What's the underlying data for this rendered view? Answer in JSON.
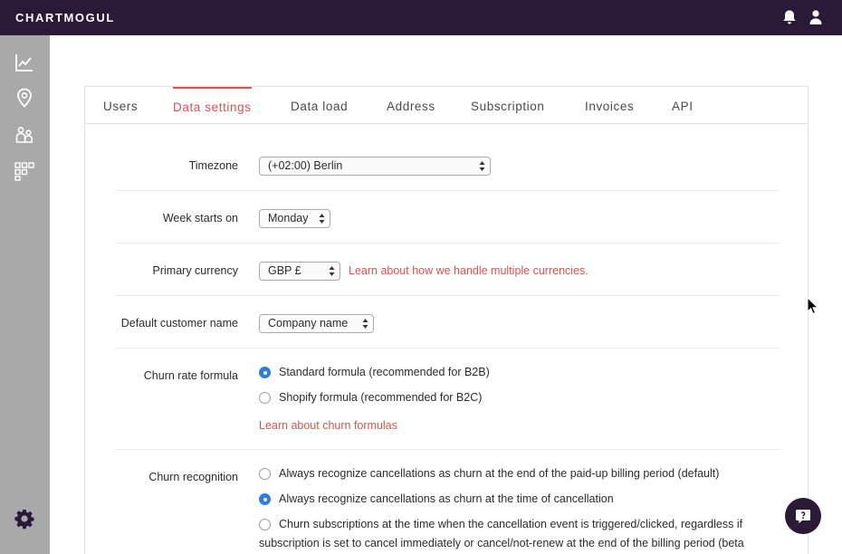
{
  "app": {
    "logo": "CHARTMOGUL"
  },
  "topbar": {
    "icons": [
      "bell-icon",
      "user-icon"
    ]
  },
  "sidebar": {
    "icons": [
      "chart-icon",
      "location-pin-icon",
      "customers-icon",
      "segments-grid-icon"
    ],
    "footer_icon": "gear-icon"
  },
  "tabs": [
    {
      "label": "Users",
      "active": false
    },
    {
      "label": "Data settings",
      "active": true
    },
    {
      "label": "Data load",
      "active": false
    },
    {
      "label": "Address",
      "active": false
    },
    {
      "label": "Subscription",
      "active": false
    },
    {
      "label": "Invoices",
      "active": false
    },
    {
      "label": "API",
      "active": false
    }
  ],
  "settings": {
    "timezone": {
      "label": "Timezone",
      "value": "(+02:00) Berlin"
    },
    "week_start": {
      "label": "Week starts on",
      "value": "Monday"
    },
    "currency": {
      "label": "Primary currency",
      "value": "GBP £",
      "link": "Learn about how we handle multiple currencies."
    },
    "customer_name": {
      "label": "Default customer name",
      "value": "Company name"
    },
    "churn_formula": {
      "label": "Churn rate formula",
      "options": [
        {
          "label": "Standard formula (recommended for B2B)",
          "checked": true
        },
        {
          "label": "Shopify formula (recommended for B2C)",
          "checked": false
        }
      ],
      "link": "Learn about churn formulas"
    },
    "churn_recognition": {
      "label": "Churn recognition",
      "options": [
        {
          "label": "Always recognize cancellations as churn at the end of the paid-up billing period (default)",
          "checked": false
        },
        {
          "label": "Always recognize cancellations as churn at the time of cancellation",
          "checked": true
        },
        {
          "label": "Churn subscriptions at the time when the cancellation event is triggered/clicked, regardless if",
          "checked": false
        }
      ],
      "option3_line2": "subscription is set to cancel immediately or cancel/not-renew at the end of the billing period (beta"
    }
  },
  "colors": {
    "topbar": "#2b1a37",
    "sidebar": "#a9a9a9",
    "accent": "#d9534f",
    "radio_checked": "#2c7fe0"
  }
}
